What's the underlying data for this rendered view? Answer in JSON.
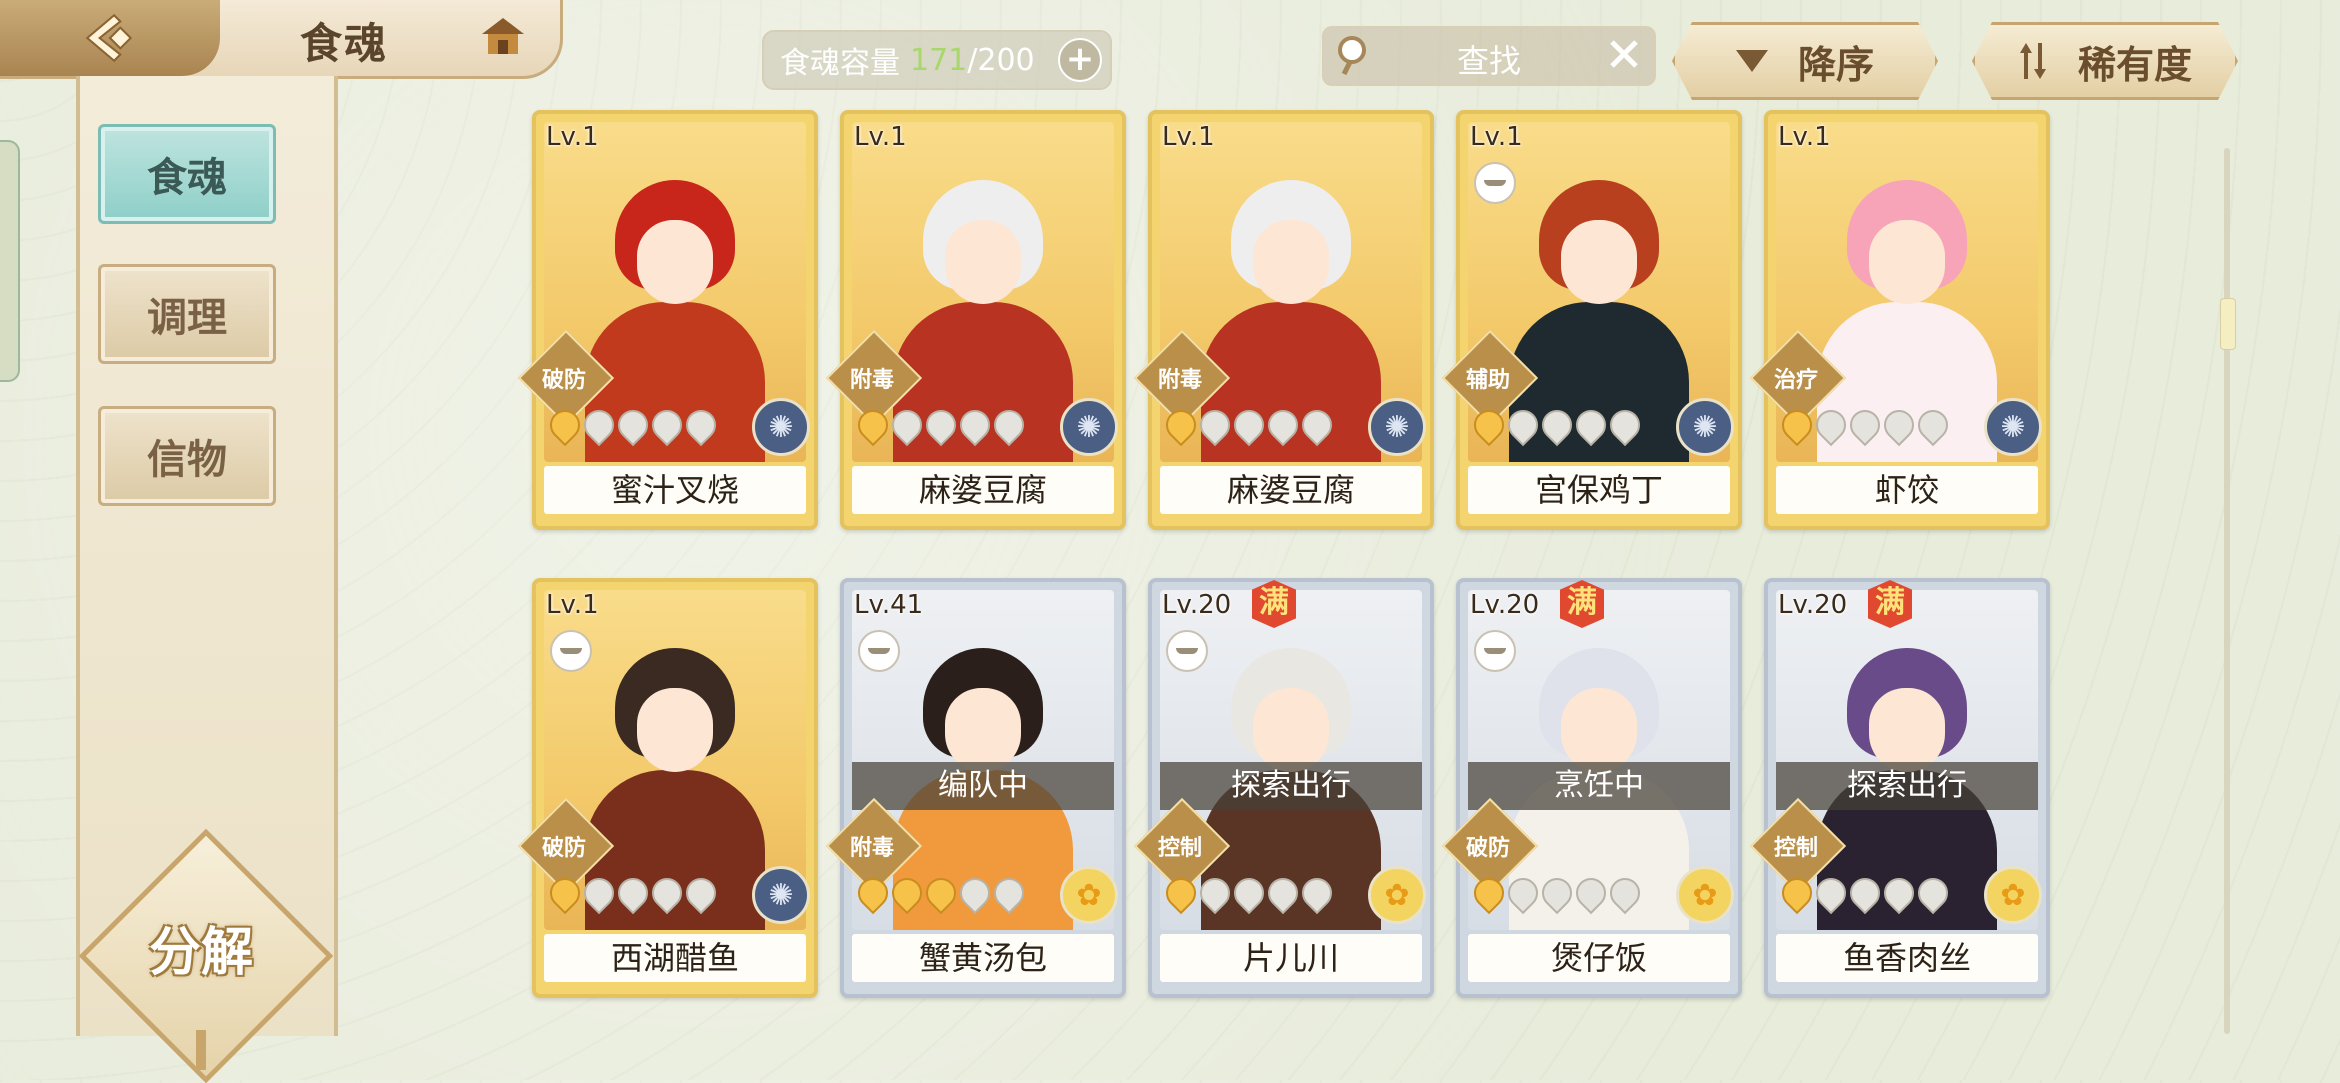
{
  "header": {
    "title": "食魂",
    "capacity_label": "食魂容量",
    "capacity_current": "171",
    "capacity_max": "/200",
    "search_placeholder": "查找",
    "sort_order_label": "降序",
    "sort_by_label": "稀有度"
  },
  "sidebar": {
    "tabs": [
      {
        "label": "食魂",
        "active": true
      },
      {
        "label": "调理",
        "active": false
      },
      {
        "label": "信物",
        "active": false
      }
    ],
    "decompose_label": "分解"
  },
  "scroll": {
    "position": 0.18
  },
  "cards": [
    {
      "level": "Lv.1",
      "name": "蜜汁叉烧",
      "role": "破防",
      "stars_lit": 1,
      "frame": "gold",
      "element": "moon",
      "status": "",
      "full": "",
      "portrait": {
        "hair": "#c8261b",
        "body": "#c23a1e"
      }
    },
    {
      "level": "Lv.1",
      "name": "麻婆豆腐",
      "role": "附毒",
      "stars_lit": 1,
      "frame": "gold",
      "element": "moon",
      "status": "",
      "full": "",
      "portrait": {
        "hair": "#eeeeee",
        "body": "#b83322"
      }
    },
    {
      "level": "Lv.1",
      "name": "麻婆豆腐",
      "role": "附毒",
      "stars_lit": 1,
      "frame": "gold",
      "element": "moon",
      "status": "",
      "full": "",
      "portrait": {
        "hair": "#eeeeee",
        "body": "#b83322"
      }
    },
    {
      "level": "Lv.1",
      "name": "宫保鸡丁",
      "role": "辅助",
      "stars_lit": 1,
      "frame": "gold",
      "element": "moon",
      "status": "",
      "full": "",
      "bowl": true,
      "portrait": {
        "hair": "#b8401f",
        "body": "#1f2a30"
      }
    },
    {
      "level": "Lv.1",
      "name": "虾饺",
      "role": "治疗",
      "stars_lit": 1,
      "frame": "gold",
      "element": "moon",
      "status": "",
      "full": "",
      "portrait": {
        "hair": "#f7a3b8",
        "body": "#fbeff2"
      }
    },
    {
      "level": "Lv.1",
      "name": "西湖醋鱼",
      "role": "破防",
      "stars_lit": 1,
      "frame": "gold",
      "element": "moon",
      "status": "",
      "full": "",
      "bowl": true,
      "portrait": {
        "hair": "#3a2a22",
        "body": "#7a2f1c"
      }
    },
    {
      "level": "Lv.41",
      "name": "蟹黄汤包",
      "role": "附毒",
      "stars_lit": 3,
      "frame": "silver",
      "element": "sun",
      "status": "编队中",
      "full": "",
      "bowl": true,
      "portrait": {
        "hair": "#2a1f1a",
        "body": "#f19a3d"
      }
    },
    {
      "level": "Lv.20",
      "name": "片儿川",
      "role": "控制",
      "stars_lit": 1,
      "frame": "silver",
      "element": "sun",
      "status": "探索出行",
      "full": "满",
      "bowl": true,
      "portrait": {
        "hair": "#e9e7e2",
        "body": "#5a3425"
      }
    },
    {
      "level": "Lv.20",
      "name": "煲仔饭",
      "role": "破防",
      "stars_lit": 1,
      "frame": "silver",
      "element": "sun",
      "status": "烹饪中",
      "full": "满",
      "bowl": true,
      "portrait": {
        "hair": "#dfe2ea",
        "body": "#f4f1ea"
      }
    },
    {
      "level": "Lv.20",
      "name": "鱼香肉丝",
      "role": "控制",
      "stars_lit": 1,
      "frame": "silver",
      "element": "sun",
      "status": "探索出行",
      "full": "满",
      "portrait": {
        "hair": "#6a4b8a",
        "body": "#2a2230"
      }
    }
  ]
}
